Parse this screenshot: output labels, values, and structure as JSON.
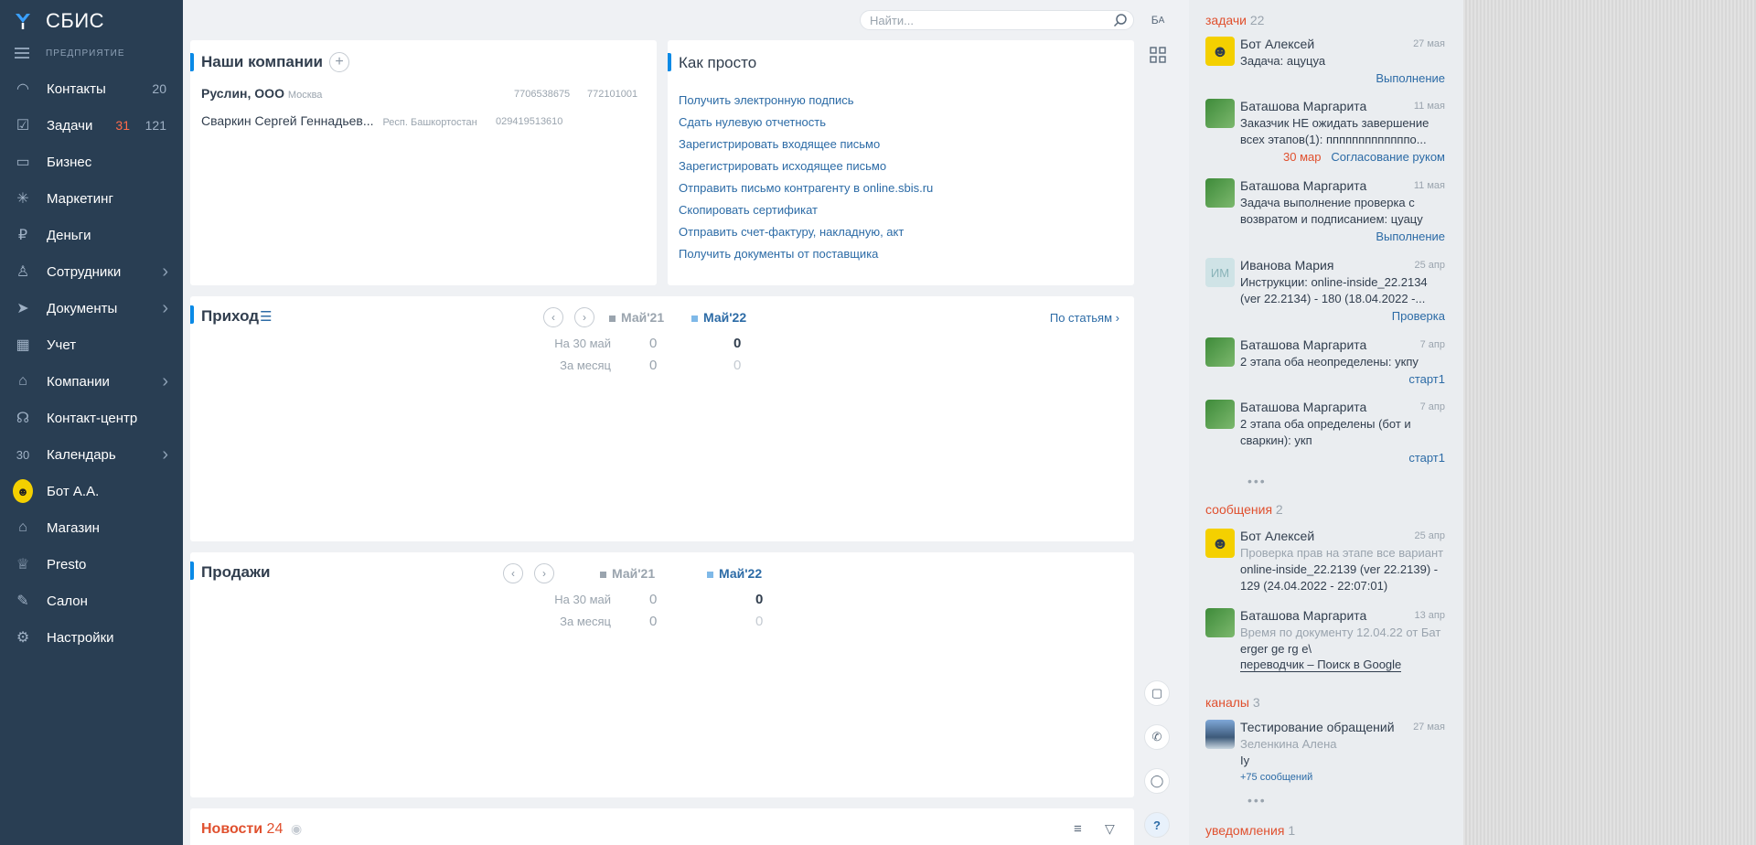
{
  "sidebar": {
    "logo": "СБИС",
    "section_caption": "ПРЕДПРИЯТИЕ",
    "items": [
      {
        "label": "Контакты",
        "count": "20"
      },
      {
        "label": "Задачи",
        "count_red": "31",
        "count": "121"
      },
      {
        "label": "Бизнес"
      },
      {
        "label": "Маркетинг"
      },
      {
        "label": "Деньги"
      },
      {
        "label": "Сотрудники",
        "chevron": true
      },
      {
        "label": "Документы",
        "chevron": true
      },
      {
        "label": "Учет"
      },
      {
        "label": "Компании",
        "chevron": true
      },
      {
        "label": "Контакт-центр"
      },
      {
        "label": "Календарь",
        "icon_text": "30",
        "chevron": true
      },
      {
        "label": "Бот А.А."
      },
      {
        "label": "Магазин"
      },
      {
        "label": "Presto"
      },
      {
        "label": "Салон"
      },
      {
        "label": "Настройки"
      }
    ]
  },
  "search": {
    "placeholder": "Найти..."
  },
  "companies": {
    "title": "Наши компании",
    "rows": [
      {
        "name": "Руслин, ООО",
        "region": "Москва",
        "inn": "7706538675",
        "kpp": "772101001"
      },
      {
        "name": "Сваркин Сергей Геннадьев...",
        "region": "Респ. Башкортостан",
        "inn": "029419513610",
        "kpp": ""
      }
    ]
  },
  "howto": {
    "title": "Как просто",
    "links": [
      "Получить электронную подпись",
      "Сдать нулевую отчетность",
      "Зарегистрировать входящее письмо",
      "Зарегистрировать исходящее письмо",
      "Отправить письмо контрагенту в online.sbis.ru",
      "Скопировать сертификат",
      "Отправить счет-фактуру, накладную, акт",
      "Получить документы от поставщика"
    ]
  },
  "income": {
    "title": "Приход",
    "period_a": "Май'21",
    "period_b": "Май'22",
    "by_items": "По статьям",
    "row1_label": "На 30 май",
    "row1_a": "0",
    "row1_b": "0",
    "row2_label": "За месяц",
    "row2_a": "0",
    "row2_b": "0"
  },
  "sales": {
    "title": "Продажи",
    "period_a": "Май'21",
    "period_b": "Май'22",
    "row1_label": "На 30 май",
    "row1_a": "0",
    "row1_b": "0",
    "row2_label": "За месяц",
    "row2_a": "0",
    "row2_b": "0"
  },
  "news": {
    "title": "Новости",
    "count": "24"
  },
  "rightpanel": {
    "tasks_label": "задачи",
    "tasks_count": "22",
    "tasks": [
      {
        "who": "Бот Алексей",
        "date": "27 мая",
        "text": "Задача: ацуцуа",
        "status": "Выполнение"
      },
      {
        "who": "Баташова Маргарита",
        "date": "11 мая",
        "text": "Заказчик НЕ ожидать завершение всех этапов(1): пппппппппппппо...",
        "due": "30 мар",
        "status": "Согласование руком"
      },
      {
        "who": "Баташова Маргарита",
        "date": "11 мая",
        "text": "Задача выполнение проверка с возвратом и подписанием: цуацу",
        "status": "Выполнение"
      },
      {
        "who": "Иванова Мария",
        "initials": "ИМ",
        "date": "25 апр",
        "text": "Инструкции: online-inside_22.2134 (ver 22.2134) - 180 (18.04.2022 -...",
        "status": "Проверка"
      },
      {
        "who": "Баташова Маргарита",
        "date": "7 апр",
        "text": "2 этапа оба неопределены: укпу",
        "status": "старт1"
      },
      {
        "who": "Баташова Маргарита",
        "date": "7 апр",
        "text": "2 этапа оба определены (бот и сваркин): укп",
        "status": "старт1"
      }
    ],
    "messages_label": "сообщения",
    "messages_count": "2",
    "messages": [
      {
        "who": "Бот Алексей",
        "date": "25 апр",
        "muted": "Проверка прав на этапе все вариант",
        "text": "online-inside_22.2139 (ver 22.2139) - 129 (24.04.2022 - 22:07:01)"
      },
      {
        "who": "Баташова Маргарита",
        "date": "13 апр",
        "muted": "Время по документу 12.04.22 от Бат",
        "text": "erger ge rg e\\",
        "link": "переводчик – Поиск в Google"
      }
    ],
    "channels_label": "каналы",
    "channels_count": "3",
    "channel": {
      "who": "Тестирование обращений",
      "date": "27 мая",
      "author": "Зеленкина Алена",
      "text": "Iy",
      "more": "+75 сообщений"
    },
    "notifications_label": "уведомления",
    "notifications_count": "1"
  },
  "colors": {
    "sidebar": "#293e53",
    "accent": "#0a8ae6",
    "link": "#2c6ba6",
    "section": "#e0502e"
  }
}
